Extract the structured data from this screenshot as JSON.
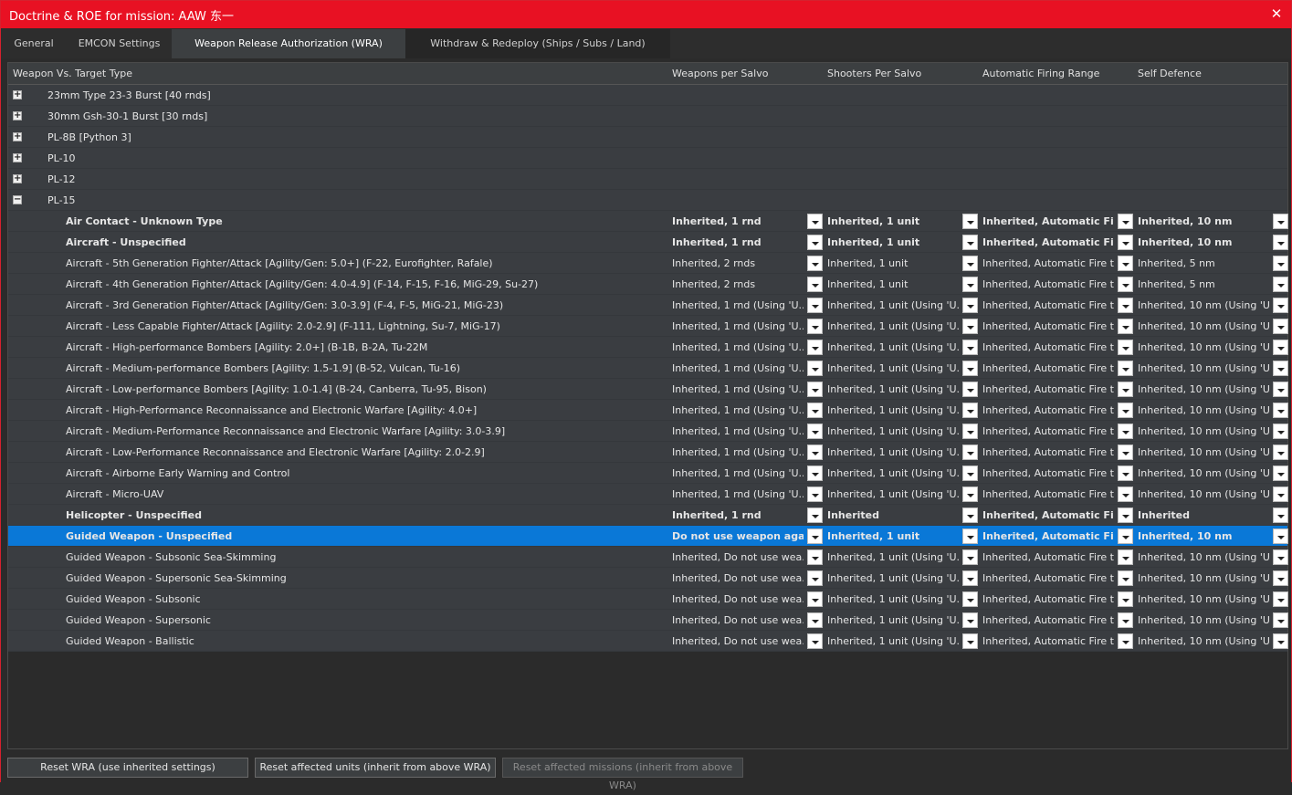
{
  "window": {
    "title": "Doctrine & ROE for mission: AAW 东一",
    "close_glyph": "✕"
  },
  "tabs": [
    {
      "label": "General"
    },
    {
      "label": "EMCON Settings"
    },
    {
      "label": "Weapon Release Authorization (WRA)"
    },
    {
      "label": "Withdraw & Redeploy (Ships / Subs / Land)"
    }
  ],
  "active_tab": "Weapon Release Authorization (WRA)",
  "columns": {
    "weapon_target": "Weapon Vs. Target Type",
    "weapons_per_salvo": "Weapons per Salvo",
    "shooters_per_salvo": "Shooters Per Salvo",
    "auto_fire_range": "Automatic Firing Range",
    "self_defence": "Self Defence"
  },
  "weapons": [
    {
      "name": "23mm Type 23-3 Burst [40 rnds]",
      "expander": "+"
    },
    {
      "name": "30mm Gsh-30-1 Burst [30 rnds]",
      "expander": "+"
    },
    {
      "name": "PL-8B [Python 3]",
      "expander": "+"
    },
    {
      "name": "PL-10",
      "expander": "+"
    },
    {
      "name": "PL-12",
      "expander": "+"
    },
    {
      "name": "PL-15",
      "expander": "−"
    }
  ],
  "targets": [
    {
      "name": "Air Contact - Unknown Type",
      "bold": true,
      "wps": "Inherited, 1 rnd",
      "sps": "Inherited, 1 unit",
      "afr": "Inherited, Automatic Fir...",
      "sd": "Inherited, 10 nm"
    },
    {
      "name": "Aircraft - Unspecified",
      "bold": true,
      "wps": "Inherited, 1 rnd",
      "sps": "Inherited, 1 unit",
      "afr": "Inherited, Automatic Fir...",
      "sd": "Inherited, 10 nm"
    },
    {
      "name": "Aircraft - 5th Generation Fighter/Attack [Agility/Gen: 5.0+] (F-22, Eurofighter, Rafale)",
      "wps": "Inherited, 2 rnds",
      "sps": "Inherited, 1 unit",
      "afr": "Inherited, Automatic Fire t...",
      "sd": "Inherited, 5 nm"
    },
    {
      "name": "Aircraft - 4th Generation Fighter/Attack [Agility/Gen: 4.0-4.9] (F-14, F-15, F-16, MiG-29, Su-27)",
      "wps": "Inherited, 2 rnds",
      "sps": "Inherited, 1 unit",
      "afr": "Inherited, Automatic Fire t...",
      "sd": "Inherited, 5 nm"
    },
    {
      "name": "Aircraft - 3rd Generation Fighter/Attack [Agility/Gen: 3.0-3.9] (F-4, F-5, MiG-21, MiG-23)",
      "wps": "Inherited, 1 rnd (Using 'U...",
      "sps": "Inherited, 1 unit (Using 'U...",
      "afr": "Inherited, Automatic Fire t...",
      "sd": "Inherited, 10 nm (Using 'U..."
    },
    {
      "name": "Aircraft - Less Capable Fighter/Attack [Agility: 2.0-2.9] (F-111, Lightning, Su-7, MiG-17)",
      "wps": "Inherited, 1 rnd (Using 'U...",
      "sps": "Inherited, 1 unit (Using 'U...",
      "afr": "Inherited, Automatic Fire t...",
      "sd": "Inherited, 10 nm (Using 'U..."
    },
    {
      "name": "Aircraft - High-performance Bombers [Agility: 2.0+] (B-1B, B-2A, Tu-22M",
      "wps": "Inherited, 1 rnd (Using 'U...",
      "sps": "Inherited, 1 unit (Using 'U...",
      "afr": "Inherited, Automatic Fire t...",
      "sd": "Inherited, 10 nm (Using 'U..."
    },
    {
      "name": "Aircraft - Medium-performance Bombers [Agility: 1.5-1.9] (B-52, Vulcan, Tu-16)",
      "wps": "Inherited, 1 rnd (Using 'U...",
      "sps": "Inherited, 1 unit (Using 'U...",
      "afr": "Inherited, Automatic Fire t...",
      "sd": "Inherited, 10 nm (Using 'U..."
    },
    {
      "name": "Aircraft - Low-performance Bombers [Agility: 1.0-1.4] (B-24, Canberra, Tu-95, Bison)",
      "wps": "Inherited, 1 rnd (Using 'U...",
      "sps": "Inherited, 1 unit (Using 'U...",
      "afr": "Inherited, Automatic Fire t...",
      "sd": "Inherited, 10 nm (Using 'U..."
    },
    {
      "name": "Aircraft - High-Performance Reconnaissance and Electronic Warfare [Agility: 4.0+]",
      "wps": "Inherited, 1 rnd (Using 'U...",
      "sps": "Inherited, 1 unit (Using 'U...",
      "afr": "Inherited, Automatic Fire t...",
      "sd": "Inherited, 10 nm (Using 'U..."
    },
    {
      "name": "Aircraft - Medium-Performance Reconnaissance and Electronic Warfare [Agility: 3.0-3.9]",
      "wps": "Inherited, 1 rnd (Using 'U...",
      "sps": "Inherited, 1 unit (Using 'U...",
      "afr": "Inherited, Automatic Fire t...",
      "sd": "Inherited, 10 nm (Using 'U..."
    },
    {
      "name": "Aircraft - Low-Performance Reconnaissance and Electronic Warfare [Agility: 2.0-2.9]",
      "wps": "Inherited, 1 rnd (Using 'U...",
      "sps": "Inherited, 1 unit (Using 'U...",
      "afr": "Inherited, Automatic Fire t...",
      "sd": "Inherited, 10 nm (Using 'U..."
    },
    {
      "name": "Aircraft - Airborne Early Warning and Control",
      "wps": "Inherited, 1 rnd (Using 'U...",
      "sps": "Inherited, 1 unit (Using 'U...",
      "afr": "Inherited, Automatic Fire t...",
      "sd": "Inherited, 10 nm (Using 'U..."
    },
    {
      "name": "Aircraft - Micro-UAV",
      "wps": "Inherited, 1 rnd (Using 'U...",
      "sps": "Inherited, 1 unit (Using 'U...",
      "afr": "Inherited, Automatic Fire t...",
      "sd": "Inherited, 10 nm (Using 'U..."
    },
    {
      "name": "Helicopter - Unspecified",
      "bold": true,
      "wps": "Inherited, 1 rnd",
      "sps": "Inherited",
      "afr": "Inherited, Automatic Fir...",
      "sd": "Inherited"
    },
    {
      "name": "Guided Weapon - Unspecified",
      "bold": true,
      "selected": true,
      "wps": "Do not use weapon agai...",
      "sps": "Inherited, 1 unit",
      "afr": "Inherited, Automatic Fir...",
      "sd": "Inherited, 10 nm"
    },
    {
      "name": "Guided Weapon - Subsonic Sea-Skimming",
      "wps": "Inherited, Do not use wea...",
      "sps": "Inherited, 1 unit (Using 'U...",
      "afr": "Inherited, Automatic Fire t...",
      "sd": "Inherited, 10 nm (Using 'U..."
    },
    {
      "name": "Guided Weapon - Supersonic Sea-Skimming",
      "wps": "Inherited, Do not use wea...",
      "sps": "Inherited, 1 unit (Using 'U...",
      "afr": "Inherited, Automatic Fire t...",
      "sd": "Inherited, 10 nm (Using 'U..."
    },
    {
      "name": "Guided Weapon - Subsonic",
      "wps": "Inherited, Do not use wea...",
      "sps": "Inherited, 1 unit (Using 'U...",
      "afr": "Inherited, Automatic Fire t...",
      "sd": "Inherited, 10 nm (Using 'U..."
    },
    {
      "name": "Guided Weapon - Supersonic",
      "wps": "Inherited, Do not use wea...",
      "sps": "Inherited, 1 unit (Using 'U...",
      "afr": "Inherited, Automatic Fire t...",
      "sd": "Inherited, 10 nm (Using 'U..."
    },
    {
      "name": "Guided Weapon - Ballistic",
      "wps": "Inherited, Do not use wea...",
      "sps": "Inherited, 1 unit (Using 'U...",
      "afr": "Inherited, Automatic Fire t...",
      "sd": "Inherited, 10 nm (Using 'U..."
    }
  ],
  "footer": {
    "reset_wra": "Reset WRA (use inherited settings)",
    "reset_units": "Reset affected units (inherit from above WRA)",
    "reset_missions": "Reset affected missions (inherit from above WRA)"
  },
  "colors": {
    "title_bar": "#e81123",
    "selection": "#0a78d7",
    "row_bg": "#3a3d41",
    "header_bg": "#3c3f41"
  }
}
